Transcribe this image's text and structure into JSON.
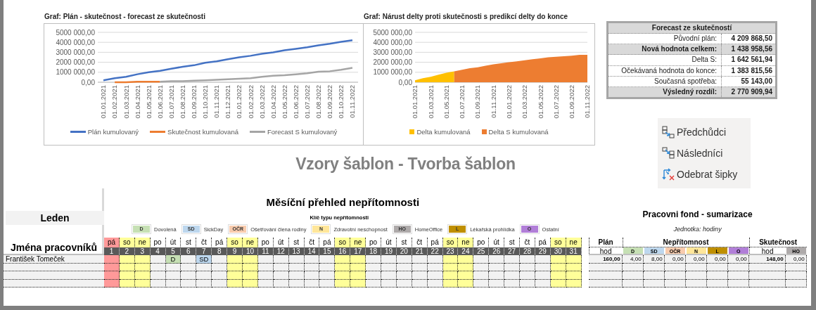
{
  "charts": [
    {
      "title": "Graf: Plán - skutečnost - forecast ze skutečnosti",
      "chart_data": {
        "type": "line",
        "categories": [
          "01.01.2021",
          "01.02.2021",
          "01.03.2021",
          "01.04.2021",
          "01.05.2021",
          "01.06.2021",
          "01.07.2021",
          "01.08.2021",
          "01.09.2021",
          "01.10.2021",
          "01.11.2021",
          "01.12.2021",
          "01.01.2022",
          "01.02.2022",
          "01.03.2022",
          "01.04.2022",
          "01.05.2022",
          "01.06.2022",
          "01.07.2022",
          "01.08.2022",
          "01.09.2022",
          "01.10.2022",
          "01.11.2022"
        ],
        "ylim": [
          0,
          5000000
        ],
        "yticks": [
          {
            "value": 0,
            "label": "0,00"
          },
          {
            "value": 1000000,
            "label": "1000 000,00"
          },
          {
            "value": 2000000,
            "label": "2000 000,00"
          },
          {
            "value": 3000000,
            "label": "3000 000,00"
          },
          {
            "value": 4000000,
            "label": "4000 000,00"
          },
          {
            "value": 5000000,
            "label": "5000 000,00"
          }
        ],
        "grid": true,
        "legend": true,
        "series": [
          {
            "name": "Plán kumulovaný",
            "color": "#4472c4",
            "values": [
              200000,
              400000,
              550000,
              800000,
              1000000,
              1150000,
              1350000,
              1550000,
              1700000,
              1950000,
              2100000,
              2300000,
              2500000,
              2650000,
              2850000,
              3000000,
              3200000,
              3350000,
              3500000,
              3700000,
              3850000,
              4050000,
              4200000
            ]
          },
          {
            "name": "Skutečnost kumulovaná",
            "color": "#ed7d31",
            "values": [
              null,
              0,
              0,
              50000,
              50000,
              50000,
              null,
              null,
              null,
              null,
              null,
              null,
              null,
              null,
              null,
              null,
              null,
              null,
              null,
              null,
              null,
              null,
              null
            ]
          },
          {
            "name": "Forecast S kumulovaný",
            "color": "#a5a5a5",
            "values": [
              null,
              null,
              null,
              null,
              null,
              50000,
              100000,
              100000,
              150000,
              200000,
              250000,
              300000,
              350000,
              400000,
              550000,
              650000,
              700000,
              800000,
              900000,
              1050000,
              1100000,
              1250000,
              1450000
            ]
          }
        ]
      }
    },
    {
      "title": "Graf: Nárust delty proti skutečnosti s predikcí delty do konce",
      "chart_data": {
        "type": "area",
        "categories": [
          "01.01.2021",
          null,
          "01.03.2021",
          null,
          "01.05.2021",
          null,
          "01.07.2021",
          null,
          "01.09.2021",
          null,
          "01.11.2021",
          null,
          "01.01.2022",
          null,
          "01.03.2022",
          null,
          "01.05.2022",
          null,
          "01.07.2022",
          null,
          "01.09.2022",
          null,
          "01.11.2022"
        ],
        "ylim": [
          0,
          5000000
        ],
        "yticks": [
          {
            "value": 0,
            "label": "0,00"
          },
          {
            "value": 1000000,
            "label": "1000 000,00"
          },
          {
            "value": 2000000,
            "label": "2000 000,00"
          },
          {
            "value": 3000000,
            "label": "3000 000,00"
          },
          {
            "value": 4000000,
            "label": "4000 000,00"
          },
          {
            "value": 5000000,
            "label": "5000 000,00"
          }
        ],
        "grid": true,
        "legend": true,
        "series": [
          {
            "name": "Delta kumulovaná",
            "color": "#ffc000",
            "values": [
              200000,
              400000,
              550000,
              750000,
              950000,
              1100000,
              null,
              null,
              null,
              null,
              null,
              null,
              null,
              null,
              null,
              null,
              null,
              null,
              null,
              null,
              null,
              null,
              null
            ]
          },
          {
            "name": "Delta S kumulovaná",
            "color": "#ed7d31",
            "values": [
              null,
              null,
              null,
              null,
              null,
              1100000,
              1250000,
              1400000,
              1500000,
              1650000,
              1800000,
              1900000,
              2000000,
              2100000,
              2200000,
              2300000,
              2400000,
              2500000,
              2550000,
              2600000,
              2650000,
              2750000,
              2750000
            ]
          }
        ]
      }
    }
  ],
  "forecast": {
    "title": "Forecast ze skutečností",
    "rows": [
      {
        "label": "Původní plán:",
        "value": "4 209 868,50",
        "highlighted": false
      },
      {
        "label": "Nová hodnota celkem:",
        "value": "1 438 958,56",
        "highlighted": true
      },
      {
        "label": "Delta S:",
        "value": "1 642 561,94",
        "highlighted": false
      },
      {
        "label": "Očekávaná hodnota do konce:",
        "value": "1 383 815,56",
        "highlighted": false
      },
      {
        "label": "Současná spotřeba:",
        "value": "55 143,00",
        "highlighted": false
      },
      {
        "label": "Výsledný rozdíl:",
        "value": "2 770 909,94",
        "highlighted": true
      }
    ]
  },
  "tools": [
    {
      "label": "Předchůdci",
      "kind": "precedents"
    },
    {
      "label": "Následníci",
      "kind": "dependents"
    },
    {
      "label": "Odebrat šipky",
      "kind": "remove"
    }
  ],
  "heading": "Vzory šablon - Tvorba šablon",
  "absence": {
    "title": "Měsíční přehled nepřítomnosti",
    "month": "Leden",
    "names_header": "Jména pracovníků",
    "legend_title": "Klíč typu nepřítomnosti",
    "legend": [
      {
        "code": "D",
        "label": "Dovolená",
        "color": "#c6e0b4"
      },
      {
        "code": "SD",
        "label": "SickDay",
        "color": "#bdd7ee"
      },
      {
        "code": "OČR",
        "label": "Ošetřování člena rodiny",
        "color": "#f8cbad"
      },
      {
        "code": "N",
        "label": "Zdravotní neschopnost",
        "color": "#ffe699"
      },
      {
        "code": "HO",
        "label": "HomeOffice",
        "color": "#aeaaaa"
      },
      {
        "code": "L",
        "label": "Lékařská prohlídka",
        "color": "#bf8f00"
      },
      {
        "code": "O",
        "label": "Ostatní",
        "color": "#b17ed8"
      }
    ],
    "days": [
      {
        "name": "pá",
        "number": "1",
        "kind": "holiday"
      },
      {
        "name": "so",
        "number": "2",
        "kind": "weekend"
      },
      {
        "name": "ne",
        "number": "3",
        "kind": "weekend"
      },
      {
        "name": "po",
        "number": "4",
        "kind": "workday"
      },
      {
        "name": "út",
        "number": "5",
        "kind": "workday"
      },
      {
        "name": "st",
        "number": "6",
        "kind": "workday"
      },
      {
        "name": "čt",
        "number": "7",
        "kind": "workday"
      },
      {
        "name": "pá",
        "number": "8",
        "kind": "workday"
      },
      {
        "name": "so",
        "number": "9",
        "kind": "weekend"
      },
      {
        "name": "ne",
        "number": "10",
        "kind": "weekend"
      },
      {
        "name": "po",
        "number": "11",
        "kind": "workday"
      },
      {
        "name": "út",
        "number": "12",
        "kind": "workday"
      },
      {
        "name": "st",
        "number": "13",
        "kind": "workday"
      },
      {
        "name": "čt",
        "number": "14",
        "kind": "workday"
      },
      {
        "name": "pá",
        "number": "15",
        "kind": "workday"
      },
      {
        "name": "so",
        "number": "16",
        "kind": "weekend"
      },
      {
        "name": "ne",
        "number": "17",
        "kind": "weekend"
      },
      {
        "name": "po",
        "number": "18",
        "kind": "workday"
      },
      {
        "name": "út",
        "number": "19",
        "kind": "workday"
      },
      {
        "name": "st",
        "number": "20",
        "kind": "workday"
      },
      {
        "name": "čt",
        "number": "21",
        "kind": "workday"
      },
      {
        "name": "pá",
        "number": "22",
        "kind": "workday"
      },
      {
        "name": "so",
        "number": "23",
        "kind": "weekend"
      },
      {
        "name": "ne",
        "number": "24",
        "kind": "weekend"
      },
      {
        "name": "po",
        "number": "25",
        "kind": "workday"
      },
      {
        "name": "út",
        "number": "26",
        "kind": "workday"
      },
      {
        "name": "st",
        "number": "27",
        "kind": "workday"
      },
      {
        "name": "čt",
        "number": "28",
        "kind": "workday"
      },
      {
        "name": "pá",
        "number": "29",
        "kind": "workday"
      },
      {
        "name": "so",
        "number": "30",
        "kind": "weekend"
      },
      {
        "name": "ne",
        "number": "31",
        "kind": "weekend"
      }
    ],
    "employees": [
      {
        "name": "František Tomeček",
        "cells": [
          {
            "kind": "blank"
          },
          {
            "kind": "blank"
          },
          {
            "kind": "blank"
          },
          {
            "kind": "blank"
          },
          {
            "kind": "absence",
            "code": "D",
            "color": "#c6e0b4"
          },
          {
            "kind": "blank"
          },
          {
            "kind": "absence",
            "code": "SD",
            "color": "#bdd7ee"
          },
          {
            "kind": "blank"
          },
          {
            "kind": "blank"
          },
          {
            "kind": "blank"
          },
          {
            "kind": "blank"
          },
          {
            "kind": "blank"
          },
          {
            "kind": "blank"
          },
          {
            "kind": "blank"
          },
          {
            "kind": "blank"
          },
          {
            "kind": "blank"
          },
          {
            "kind": "blank"
          },
          {
            "kind": "blank"
          },
          {
            "kind": "blank"
          },
          {
            "kind": "blank"
          },
          {
            "kind": "blank"
          },
          {
            "kind": "blank"
          },
          {
            "kind": "blank"
          },
          {
            "kind": "blank"
          },
          {
            "kind": "blank"
          },
          {
            "kind": "blank"
          },
          {
            "kind": "blank"
          },
          {
            "kind": "blank"
          },
          {
            "kind": "blank"
          },
          {
            "kind": "blank"
          },
          {
            "kind": "blank"
          }
        ]
      }
    ]
  },
  "summary": {
    "title": "Pracovni fond - sumarizace",
    "unit": "Jednotka: hodiny",
    "groups": [
      {
        "label": "Plán",
        "columns": [
          {
            "label": "hod",
            "bold_values": true
          }
        ]
      },
      {
        "label": "Nepřítomnost",
        "columns": [
          {
            "label": "D",
            "color": "#c6e0b4",
            "bold_values": false
          },
          {
            "label": "SD",
            "color": "#bdd7ee",
            "bold_values": false
          },
          {
            "label": "OČR",
            "color": "#f8cbad",
            "bold_values": false
          },
          {
            "label": "N",
            "color": "#ffe699",
            "bold_values": false
          },
          {
            "label": "L",
            "color": "#bf8f00",
            "bold_values": false
          },
          {
            "label": "O",
            "color": "#b17ed8",
            "bold_values": false
          }
        ]
      },
      {
        "label": "Skutečnost",
        "columns": [
          {
            "label": "hod",
            "bold_values": true
          },
          {
            "label": "HO",
            "color": "#aeaaaa",
            "bold_values": false
          }
        ]
      }
    ],
    "rows": [
      [
        "160,00",
        "4,00",
        "8,00",
        "0,00",
        "0,00",
        "0,00",
        "0,00",
        "148,00",
        "0,00"
      ]
    ]
  }
}
